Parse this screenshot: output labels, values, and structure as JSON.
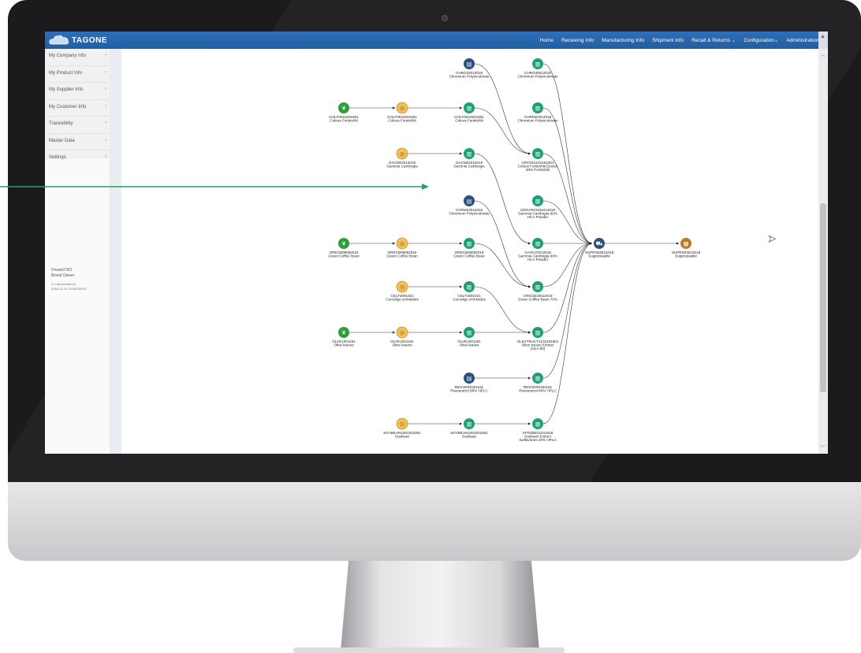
{
  "brand": {
    "name": "TAGONE"
  },
  "nav": {
    "items": [
      "Home",
      "Receiving Info",
      "Manufacturing Info",
      "Shipment Info",
      "Recall & Returns ⌄",
      "Configuration⌄",
      "Administration⌄"
    ]
  },
  "sidebar": {
    "items": [
      {
        "label": "My Company Info"
      },
      {
        "label": "My Product Info"
      },
      {
        "label": "My Supplier Info"
      },
      {
        "label": "My Customer Info"
      },
      {
        "label": "Traceability"
      },
      {
        "label": "Master Data"
      },
      {
        "label": "Settings"
      }
    ],
    "user_name": "Dream2 BO",
    "user_role": "Brand Owner",
    "last_access_label": "⊙ Last Access on",
    "last_access_time": "2018-12-11 19:24:00UTC"
  },
  "colors": {
    "navbar": "#2563a8",
    "farm": "#2e9e3a",
    "raw": "#f0c05a",
    "factory": "#1f9e78",
    "warehouse": "#2c4f7c",
    "shipment": "#2c4f7c",
    "retail": "#b8792a",
    "annotation": "#1aa85a"
  },
  "graph": {
    "nodes": [
      {
        "id": "n1",
        "type": "warehouse",
        "col": 3,
        "row": 0,
        "lines": [
          "CHRO32012019",
          "Chromium Polynicotinate"
        ]
      },
      {
        "id": "n2",
        "type": "factory",
        "col": 4,
        "row": 0,
        "lines": [
          "CHRO30012019",
          "Chromium Polynicotinate"
        ]
      },
      {
        "id": "n3",
        "type": "farm",
        "col": 1,
        "row": 1,
        "lines": [
          "COLF0918201801",
          "Coleus Forskohlii"
        ]
      },
      {
        "id": "n4",
        "type": "raw",
        "col": 2,
        "row": 1,
        "lines": [
          "COLF0918201801",
          "Coleus Forskohlii"
        ]
      },
      {
        "id": "n5",
        "type": "factory",
        "col": 3,
        "row": 1,
        "lines": [
          "COLF0918201801",
          "Coleus Forskohlii"
        ]
      },
      {
        "id": "n6",
        "type": "factory",
        "col": 4,
        "row": 1,
        "lines": [
          "CHRM22012019",
          "Chromium Polynicotinate"
        ]
      },
      {
        "id": "n7",
        "type": "raw",
        "col": 2,
        "row": 2,
        "lines": [
          "GACM22012019",
          "Garcinia Cambogia"
        ]
      },
      {
        "id": "n8",
        "type": "factory",
        "col": 3,
        "row": 2,
        "lines": [
          "GACM22012019",
          "Garcinia Cambogia"
        ]
      },
      {
        "id": "n9",
        "type": "factory",
        "col": 4,
        "row": 2,
        "lines": [
          "CRCFE1101201801",
          "Coleus Forskohlii Extract",
          "20% Forskohlii"
        ]
      },
      {
        "id": "n10",
        "type": "warehouse",
        "col": 3,
        "row": 3,
        "lines": [
          "CHRM22012019",
          "Chromium Polynicotinate"
        ]
      },
      {
        "id": "n11",
        "type": "factory",
        "col": 4,
        "row": 3,
        "lines": [
          "GDGARCM11012018",
          "Garcinia Cambogia 60%",
          "HCA Powder"
        ]
      },
      {
        "id": "n12",
        "type": "farm",
        "col": 1,
        "row": 4,
        "lines": [
          "GRECB09082018",
          "Green Coffee Bean"
        ]
      },
      {
        "id": "n13",
        "type": "raw",
        "col": 2,
        "row": 4,
        "lines": [
          "GRECB09082019",
          "Green Coffee Bean"
        ]
      },
      {
        "id": "n14",
        "type": "factory",
        "col": 3,
        "row": 4,
        "lines": [
          "GRECB09082019",
          "Green Coffee Bean"
        ]
      },
      {
        "id": "n15",
        "type": "factory",
        "col": 4,
        "row": 4,
        "lines": [
          "GAHC22012019",
          "Garcinia Cambogia 60%",
          "HCA Powder"
        ]
      },
      {
        "id": "n16",
        "type": "raw",
        "col": 2,
        "row": 5,
        "lines": [
          "CELT1901021",
          "Curculigo orchioides"
        ]
      },
      {
        "id": "n17",
        "type": "factory",
        "col": 3,
        "row": 5,
        "lines": [
          "CELT1901021",
          "Curculigo orchioides"
        ]
      },
      {
        "id": "n18",
        "type": "factory",
        "col": 4,
        "row": 5,
        "lines": [
          "CRGCB10012019",
          "Green Coffee Bean 70%"
        ]
      },
      {
        "id": "n19",
        "type": "farm",
        "col": 1,
        "row": 6,
        "lines": [
          "OLVE1001181",
          "Olive leaves"
        ]
      },
      {
        "id": "n20",
        "type": "raw",
        "col": 2,
        "row": 6,
        "lines": [
          "OLVE1001181",
          "Olive leaves"
        ]
      },
      {
        "id": "n21",
        "type": "factory",
        "col": 3,
        "row": 6,
        "lines": [
          "OLVE1001181",
          "Olive leaves"
        ]
      },
      {
        "id": "n22",
        "type": "factory",
        "col": 4,
        "row": 6,
        "lines": [
          "OLEXTRACT1101201801",
          "Olive leaves Extract",
          "(OLA 80)"
        ]
      },
      {
        "id": "n23",
        "type": "warehouse",
        "col": 3,
        "row": 7,
        "lines": [
          "RESVER0401181",
          "Resveratrol 98% HPLC"
        ]
      },
      {
        "id": "n24",
        "type": "factory",
        "col": 4,
        "row": 7,
        "lines": [
          "RESVER0401181",
          "Resveratrol 98% HPLC"
        ]
      },
      {
        "id": "n25",
        "type": "raw",
        "col": 2,
        "row": 8,
        "lines": [
          "SOYBEAN1002201801",
          "Soybean"
        ]
      },
      {
        "id": "n26",
        "type": "factory",
        "col": 3,
        "row": 8,
        "lines": [
          "SOYBEAN1002201801",
          "Soybean"
        ]
      },
      {
        "id": "n27",
        "type": "factory",
        "col": 4,
        "row": 8,
        "lines": [
          "XPSOBE11012018",
          "Soybean Extract",
          "Isoflavones 40% HPLC"
        ]
      },
      {
        "id": "n28",
        "type": "shipment",
        "col": 5,
        "row": 4,
        "lines": [
          "SUPRS03012018",
          "Suppressatile"
        ]
      },
      {
        "id": "n29",
        "type": "retail",
        "col": 6,
        "row": 4,
        "lines": [
          "SUPRS03012018",
          "Suppressatile"
        ]
      }
    ],
    "edges": [
      [
        "n3",
        "n4"
      ],
      [
        "n4",
        "n5"
      ],
      [
        "n7",
        "n8"
      ],
      [
        "n12",
        "n13"
      ],
      [
        "n13",
        "n14"
      ],
      [
        "n16",
        "n17"
      ],
      [
        "n19",
        "n20"
      ],
      [
        "n20",
        "n21"
      ],
      [
        "n23",
        "n24"
      ],
      [
        "n25",
        "n26"
      ],
      [
        "n26",
        "n27"
      ],
      [
        "n1",
        "n9"
      ],
      [
        "n5",
        "n9"
      ],
      [
        "n8",
        "n15"
      ],
      [
        "n10",
        "n18"
      ],
      [
        "n14",
        "n18"
      ],
      [
        "n17",
        "n22"
      ],
      [
        "n21",
        "n22"
      ],
      [
        "n2",
        "n28"
      ],
      [
        "n6",
        "n28"
      ],
      [
        "n9",
        "n28"
      ],
      [
        "n11",
        "n28"
      ],
      [
        "n15",
        "n28"
      ],
      [
        "n18",
        "n28"
      ],
      [
        "n22",
        "n28"
      ],
      [
        "n24",
        "n28"
      ],
      [
        "n27",
        "n28"
      ],
      [
        "n28",
        "n29"
      ]
    ]
  }
}
